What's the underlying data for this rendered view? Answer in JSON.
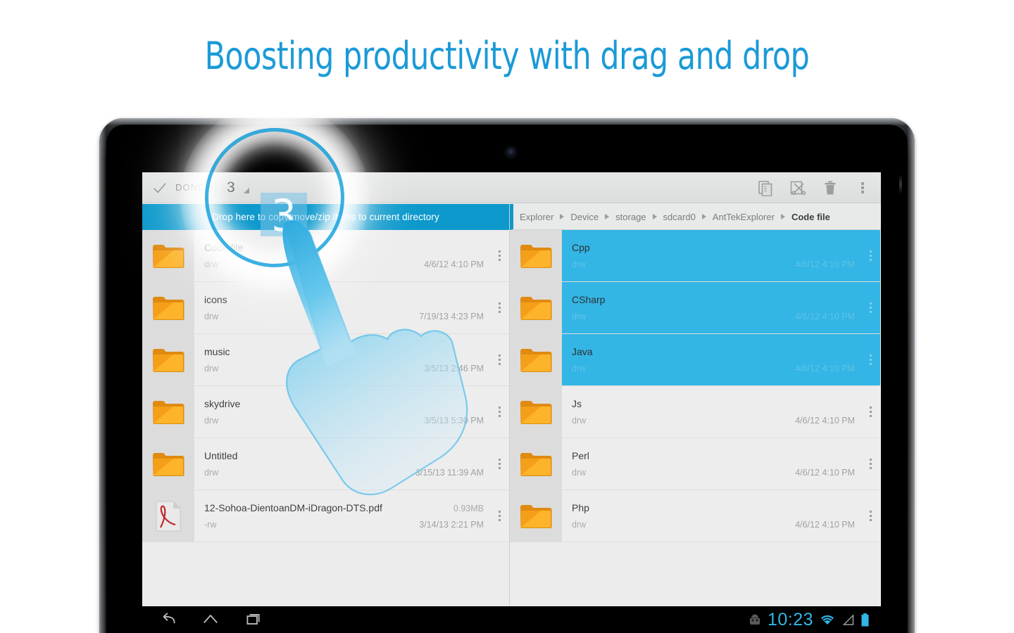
{
  "headline": "Boosting productivity with drag and drop",
  "colors": {
    "headline_blue": "#1a9ad7",
    "dropzone_blue": "#0d99cc",
    "selection_blue": "#33b5e5",
    "toolbar_gray": "#dcdddd",
    "row_gray": "#ededed",
    "folder_orange": "#f0960f"
  },
  "app_bar": {
    "check_icon": "check-icon",
    "done_label": "DONE",
    "selected_count": "3",
    "sort_caret_icon": "sort-caret-icon",
    "actions": [
      {
        "name": "copy-button",
        "icon": "copy-icon"
      },
      {
        "name": "cut-button",
        "icon": "cut-icon"
      },
      {
        "name": "delete-button",
        "icon": "trash-icon"
      },
      {
        "name": "overflow-button",
        "icon": "overflow-menu-icon"
      }
    ]
  },
  "left_pane": {
    "dropzone_text": "Drop here to copy/move/zip items to current directory",
    "rows": [
      {
        "name": "Code file",
        "perm": "drw",
        "size": "",
        "date": "4/6/12 4:10 PM",
        "icon": "folder-icon",
        "selected": false
      },
      {
        "name": "icons",
        "perm": "drw",
        "size": "",
        "date": "7/19/13 4:23 PM",
        "icon": "folder-icon",
        "selected": false
      },
      {
        "name": "music",
        "perm": "drw",
        "size": "",
        "date": "3/5/13 2:46 PM",
        "icon": "folder-icon",
        "selected": false
      },
      {
        "name": "skydrive",
        "perm": "drw",
        "size": "",
        "date": "3/5/13 5:30 PM",
        "icon": "folder-icon",
        "selected": false
      },
      {
        "name": "Untitled",
        "perm": "drw",
        "size": "",
        "date": "3/15/13 11:39 AM",
        "icon": "folder-icon",
        "selected": false
      },
      {
        "name": "12-Sohoa-DientoanDM-iDragon-DTS.pdf",
        "perm": "-rw",
        "size": "0.93MB",
        "date": "3/14/13 2:21 PM",
        "icon": "pdf-icon",
        "selected": false
      }
    ]
  },
  "right_pane": {
    "breadcrumb": [
      "Explorer",
      "Device",
      "storage",
      "sdcard0",
      "AntTekExplorer",
      "Code file"
    ],
    "rows": [
      {
        "name": "Cpp",
        "perm": "drw",
        "size": "",
        "date": "4/6/12 4:10 PM",
        "icon": "folder-icon",
        "selected": true
      },
      {
        "name": "CSharp",
        "perm": "drw",
        "size": "",
        "date": "4/6/12 4:10 PM",
        "icon": "folder-icon",
        "selected": true
      },
      {
        "name": "Java",
        "perm": "drw",
        "size": "",
        "date": "4/6/12 4:10 PM",
        "icon": "folder-icon",
        "selected": true
      },
      {
        "name": "Js",
        "perm": "drw",
        "size": "",
        "date": "4/6/12 4:10 PM",
        "icon": "folder-icon",
        "selected": false
      },
      {
        "name": "Perl",
        "perm": "drw",
        "size": "",
        "date": "4/6/12 4:10 PM",
        "icon": "folder-icon",
        "selected": false
      },
      {
        "name": "Php",
        "perm": "drw",
        "size": "",
        "date": "4/6/12 4:10 PM",
        "icon": "folder-icon",
        "selected": false
      }
    ]
  },
  "drag": {
    "count_badge": "3"
  },
  "navbar": {
    "buttons": [
      {
        "name": "back-button",
        "icon": "back-arrow-icon"
      },
      {
        "name": "home-button",
        "icon": "home-icon"
      },
      {
        "name": "recents-button",
        "icon": "recents-icon"
      }
    ],
    "status": {
      "notification_icon": "android-robot-icon",
      "clock": "10:23",
      "wifi_icon": "wifi-icon",
      "signal_icon": "signal-icon",
      "battery_icon": "battery-icon"
    }
  }
}
